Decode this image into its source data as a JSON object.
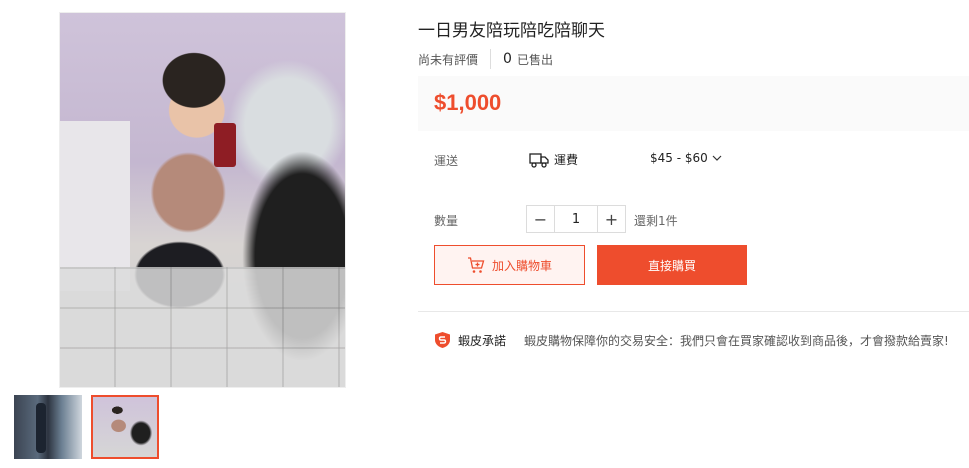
{
  "product": {
    "title": "一日男友陪玩陪吃陪聊天",
    "rating_text": "尚未有評價",
    "sold_count": "0",
    "sold_label": "已售出",
    "price": "$1,000"
  },
  "shipping": {
    "label": "運送",
    "fee_label": "運費",
    "fee_range": "$45 - $60",
    "truck_icon": "truck-icon",
    "dropdown_icon": "chevron-down-icon"
  },
  "quantity": {
    "label": "數量",
    "minus": "−",
    "value": "1",
    "plus": "+",
    "stock_text": "還剩1件"
  },
  "actions": {
    "add_to_cart": "加入購物車",
    "buy_now": "直接購買",
    "cart_icon": "cart-plus-icon"
  },
  "guarantee": {
    "title": "蝦皮承諾",
    "text": "蝦皮購物保障你的交易安全：我們只會在買家確認收到商品後，才會撥款給賣家!",
    "icon": "shield-icon"
  },
  "colors": {
    "accent": "#ee4d2d",
    "price_bg": "#fafafa",
    "cart_bg": "#fff3f1"
  },
  "gallery": {
    "thumbnail_count": 2,
    "selected_index": 1
  }
}
